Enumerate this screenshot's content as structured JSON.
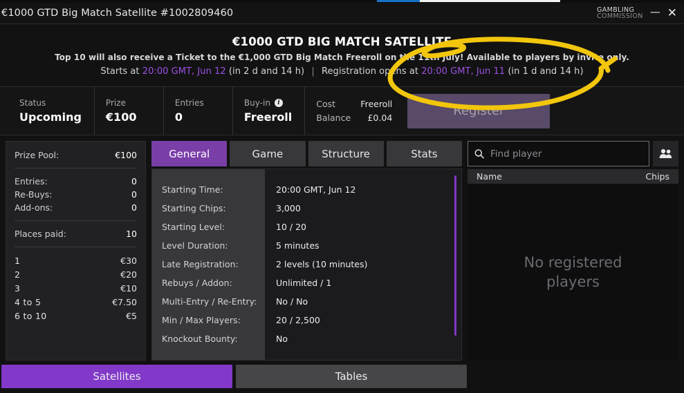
{
  "window": {
    "title": "€1000 GTD Big Match Satellite #1002809460",
    "logo_line1": "GAMBLING",
    "logo_line2": "COMMISSION",
    "minimize_glyph": "—",
    "close_glyph": "✕"
  },
  "promo": {
    "title": "€1000 GTD BIG MATCH SATELLITE",
    "subtitle": "Top 10 will also receive a Ticket to the €1,000 GTD Big Match Freeroll on the 11th July! Available to players by invite only.",
    "starts_prefix": "Starts at",
    "starts_time": "20:00 GMT, Jun 12",
    "starts_suffix": "(in 2 d and 14 h)",
    "separator": "|",
    "reg_prefix": "Registration opens at",
    "reg_time": "20:00 GMT, Jun 11",
    "reg_suffix": "(in 1 d and 14 h)",
    "annotation": "yellow-hand-drawn-circle"
  },
  "info_bar": {
    "cells": [
      {
        "label": "Status",
        "value": "Upcoming"
      },
      {
        "label": "Prize",
        "value": "€100"
      },
      {
        "label": "Entries",
        "value": "0"
      },
      {
        "label": "Buy-in",
        "value": "Freeroll",
        "has_info_icon": true,
        "info_glyph": "i"
      }
    ],
    "cost": {
      "label": "Cost",
      "value": "Freeroll"
    },
    "balance": {
      "label": "Balance",
      "value": "£0.04"
    },
    "register_label": "Register"
  },
  "prize_panel": {
    "prize_pool_label": "Prize Pool:",
    "prize_pool_value": "€100",
    "stats": [
      {
        "label": "Entries:",
        "value": "0"
      },
      {
        "label": "Re-Buys:",
        "value": "0"
      },
      {
        "label": "Add-ons:",
        "value": "0"
      }
    ],
    "places_paid_label": "Places paid:",
    "places_paid_value": "10",
    "payouts": [
      {
        "rank": "1",
        "amount": "€30"
      },
      {
        "rank": "2",
        "amount": "€20"
      },
      {
        "rank": "3",
        "amount": "€10"
      },
      {
        "rank": "4  to  5",
        "amount": "€7.50"
      },
      {
        "rank": "6  to  10",
        "amount": "€5"
      }
    ]
  },
  "tabs": [
    {
      "label": "General",
      "active": true
    },
    {
      "label": "Game",
      "active": false
    },
    {
      "label": "Structure",
      "active": false
    },
    {
      "label": "Stats",
      "active": false
    }
  ],
  "details": {
    "rows": [
      {
        "label": "Starting Time:",
        "value": "20:00 GMT, Jun 12"
      },
      {
        "label": "Starting Chips:",
        "value": "3,000"
      },
      {
        "label": "Starting Level:",
        "value": "10 / 20"
      },
      {
        "label": "Level Duration:",
        "value": "5 minutes"
      },
      {
        "label": "Late Registration:",
        "value": "2 levels (10 minutes)"
      },
      {
        "label": "Rebuys / Addon:",
        "value": "Unlimited / 1"
      },
      {
        "label": "Multi-Entry / Re-Entry:",
        "value": "No / No"
      },
      {
        "label": "Min / Max Players:",
        "value": "20 / 2,500"
      },
      {
        "label": "Knockout Bounty:",
        "value": "No"
      }
    ]
  },
  "players": {
    "search_placeholder": "Find player",
    "search_value": "",
    "col_name": "Name",
    "col_chips": "Chips",
    "empty_message": "No registered players"
  },
  "bottom_tabs": [
    {
      "label": "Satellites",
      "active": true
    },
    {
      "label": "Tables",
      "active": false
    }
  ],
  "colors": {
    "accent_purple": "#8238c8",
    "tab_active": "#7a3ea8",
    "link_purple": "#9b51e0",
    "annotation_yellow": "#f2c60c",
    "register_disabled": "#584a68"
  }
}
